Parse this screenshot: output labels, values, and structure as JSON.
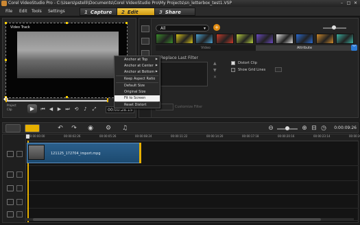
{
  "window": {
    "title": "Corel VideoStudio Pro - C:\\Users\\pstelli\\Documents\\Corel VideoStudio Pro\\My Projects\\sn_letterbox_test1.VSP",
    "minimize": "–",
    "maximize": "□",
    "close": "✕"
  },
  "menu": [
    "File",
    "Edit",
    "Tools",
    "Settings"
  ],
  "steps": [
    {
      "num": "1",
      "label": "Capture"
    },
    {
      "num": "2",
      "label": "Edit"
    },
    {
      "num": "3",
      "label": "Share"
    }
  ],
  "preview": {
    "video_label": "Video Track",
    "mode_label_1": "Project",
    "mode_label_2": "Clip",
    "timecode": "00:00:28.15"
  },
  "context_menu": {
    "items": [
      {
        "label": "Anchor at Top",
        "submenu": true
      },
      {
        "label": "Anchor at Center",
        "submenu": true
      },
      {
        "label": "Anchor at Bottom",
        "submenu": true
      },
      {
        "label": "Keep Aspect Ratio",
        "submenu": false
      },
      {
        "label": "Default Size",
        "submenu": false
      },
      {
        "label": "Original Size",
        "submenu": false
      },
      {
        "label": "Fit to Screen",
        "submenu": false,
        "highlighted": true
      },
      {
        "label": "Reset Distort",
        "submenu": false
      }
    ]
  },
  "library": {
    "category": "All",
    "tabs": [
      "Video",
      "Attribute"
    ],
    "active_tab": "Attribute",
    "replace_last_filter": "Replace Last Filter",
    "distort_clip": "Distort Clip",
    "distort_clip_checked": true,
    "show_grid_lines": "Show Grid Lines",
    "show_grid_lines_checked": false,
    "customize_filter": "Customize Filter",
    "thumb_colors": [
      "#3a8a2a",
      "#d6c21a",
      "#4aa0d0",
      "#c83a2a",
      "#b8d040",
      "#6a4ac0",
      "#e0e0e0",
      "#2a6ad0",
      "#d08a2a",
      "#3ab0a0"
    ]
  },
  "timeline": {
    "duration": "0:00:09:26",
    "ruler_ticks": [
      "00:00:00:00",
      "00:00:02:26",
      "00:00:05:26",
      "00:00:08:24",
      "00:00:11:22",
      "00:00:14:20",
      "00:00:17:18",
      "00:00:20:16",
      "00:00:23:14",
      "00:00:26:12"
    ],
    "clip_name": "121125_172704_import.mpg"
  },
  "colors": {
    "accent": "#e6b000",
    "clip": "#2b5f8c",
    "highlight": "#2c7bd6"
  }
}
